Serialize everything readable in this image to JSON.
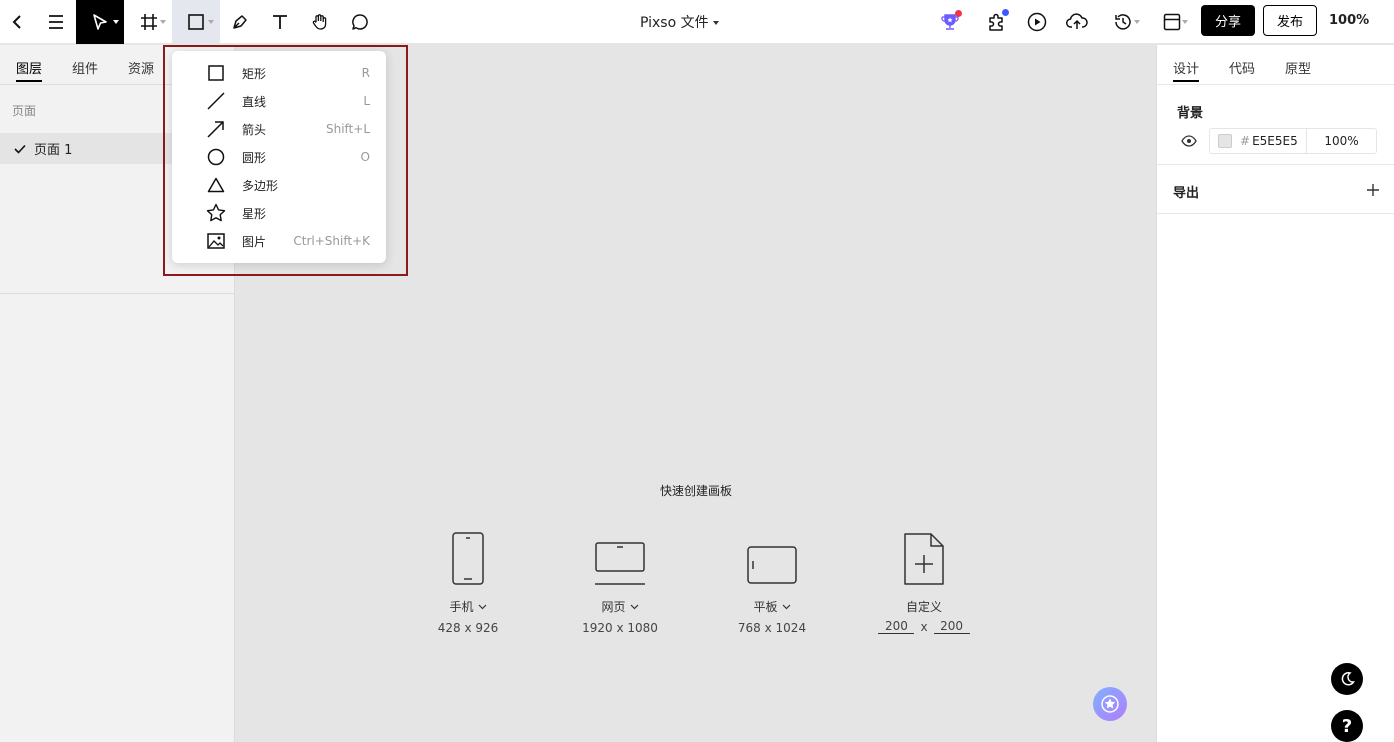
{
  "toolbar": {
    "file_title": "Pixso 文件",
    "share_label": "分享",
    "publish_label": "发布",
    "zoom": "100%"
  },
  "left_panel": {
    "tabs": [
      {
        "label": "图层"
      },
      {
        "label": "组件"
      },
      {
        "label": "资源"
      }
    ],
    "pages_label": "页面",
    "pages": [
      {
        "label": "页面 1"
      }
    ]
  },
  "shape_menu": {
    "items": [
      {
        "label": "矩形",
        "shortcut": "R",
        "icon": "rectangle-icon"
      },
      {
        "label": "直线",
        "shortcut": "L",
        "icon": "line-icon"
      },
      {
        "label": "箭头",
        "shortcut": "Shift+L",
        "icon": "arrow-icon"
      },
      {
        "label": "圆形",
        "shortcut": "O",
        "icon": "ellipse-icon"
      },
      {
        "label": "多边形",
        "shortcut": "",
        "icon": "polygon-icon"
      },
      {
        "label": "星形",
        "shortcut": "",
        "icon": "star-icon"
      },
      {
        "label": "图片",
        "shortcut": "Ctrl+Shift+K",
        "icon": "image-icon"
      }
    ]
  },
  "canvas": {
    "quick_title": "快速创建画板",
    "presets": [
      {
        "name": "手机",
        "size": "428 x 926"
      },
      {
        "name": "网页",
        "size": "1920 x 1080"
      },
      {
        "name": "平板",
        "size": "768 x 1024"
      }
    ],
    "custom": {
      "name": "自定义",
      "width": "200",
      "x": "x",
      "height": "200"
    }
  },
  "right_panel": {
    "tabs": [
      {
        "label": "设计"
      },
      {
        "label": "代码"
      },
      {
        "label": "原型"
      }
    ],
    "background_title": "背景",
    "bg_hash": "#",
    "bg_hex": "E5E5E5",
    "bg_opacity": "100%",
    "export_title": "导出",
    "help_label": "?"
  },
  "colors": {
    "canvas_bg": "#e5e5e5",
    "accent": "#000000",
    "highlight_border": "#8b1a1a"
  }
}
